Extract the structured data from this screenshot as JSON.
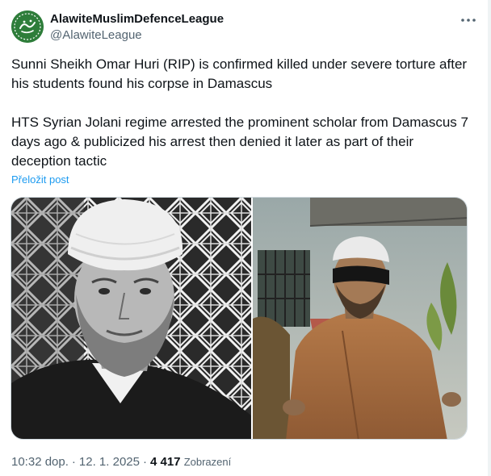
{
  "author": {
    "display_name": "AlawiteMuslimDefenceLeague",
    "handle": "@AlawiteLeague"
  },
  "icons": {
    "avatar": "avatar-logo",
    "more": "more-options-icon"
  },
  "tweet": {
    "paragraph_1": "Sunni Sheikh Omar Huri (RIP) is confirmed killed under severe torture after his students found his corpse in Damascus",
    "paragraph_2": "HTS Syrian Jolani regime arrested the prominent scholar from Damascus 7 days ago & publicized his arrest then denied it later as part of their deception tactic",
    "translate_label": "Přeložit post"
  },
  "footer": {
    "time": "10:32 dop.",
    "separator": "·",
    "date": "12. 1. 2025",
    "views_count": "4 417",
    "views_label": "Zobrazení"
  },
  "colors": {
    "text": "#0f1419",
    "secondary": "#536471",
    "link": "#1d9bf0",
    "avatar_bg": "#2f7a3b"
  }
}
